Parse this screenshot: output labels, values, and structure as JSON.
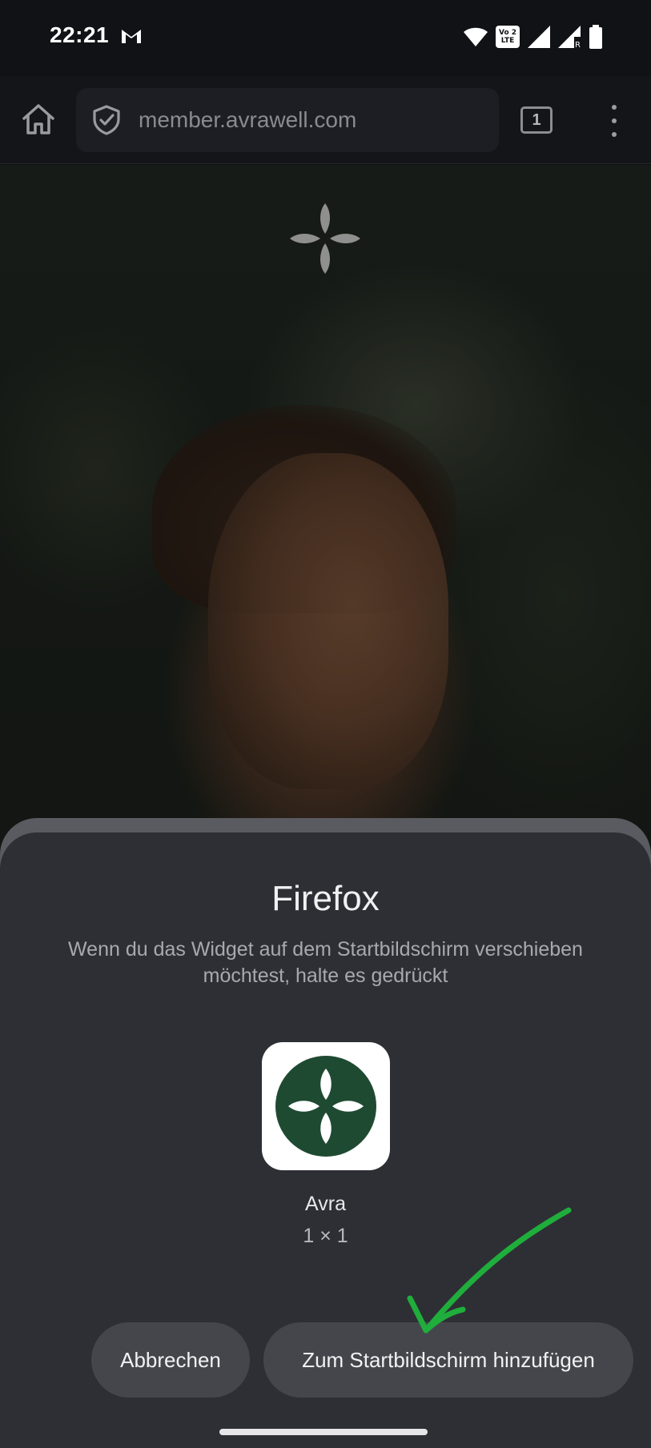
{
  "status_bar": {
    "time": "22:21",
    "icons": [
      "gmail-icon",
      "wifi-icon",
      "volte-icon",
      "signal-icon",
      "signal-roaming-icon",
      "battery-icon"
    ],
    "volte_top": "Vo 2",
    "volte_bottom": "LTE"
  },
  "browser": {
    "url": "member.avrawell.com",
    "tab_count": "1",
    "icons": [
      "home-icon",
      "shield-icon",
      "tabs-icon",
      "menu-icon"
    ]
  },
  "sheet": {
    "title": "Firefox",
    "description": "Wenn du das Widget auf dem Startbildschirm verschieben möchtest, halte es gedrückt",
    "widget_name": "Avra",
    "widget_size": "1 × 1",
    "cancel_label": "Abbrechen",
    "add_label": "Zum Startbildschirm hinzufügen"
  },
  "colors": {
    "brand_green": "#1f4a32",
    "annotation_arrow": "#1fae3c",
    "sheet_bg": "#2e2f35",
    "button_bg": "#45464c"
  }
}
